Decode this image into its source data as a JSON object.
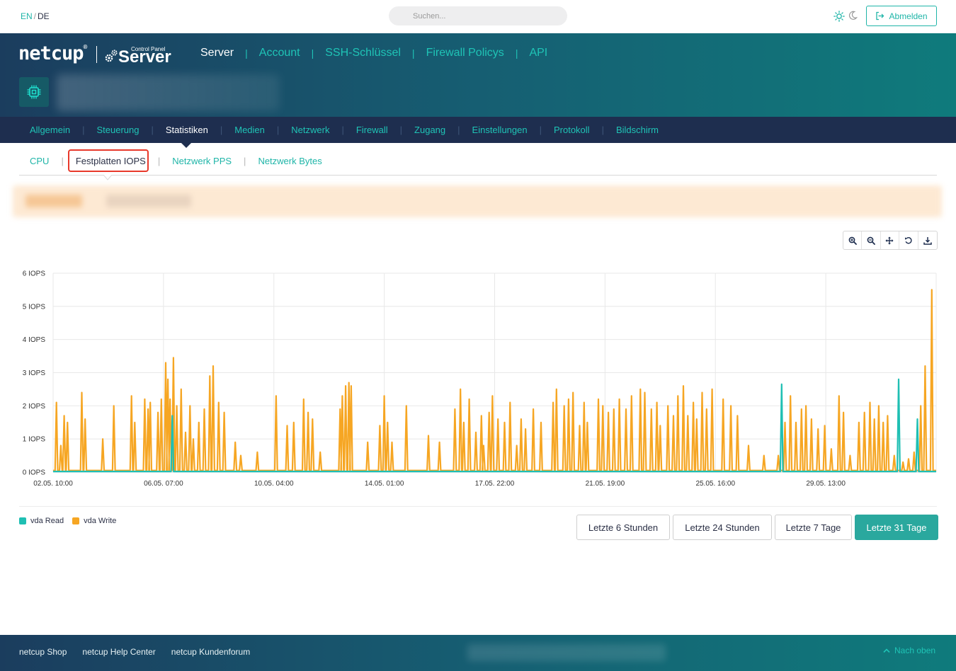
{
  "topbar": {
    "lang_en": "EN",
    "lang_sep": "/",
    "lang_de": "DE",
    "search_placeholder": "Suchen...",
    "logout_label": "Abmelden"
  },
  "brand": {
    "name": "netcup",
    "registered": "®",
    "product": "Server",
    "product_sub": "Control Panel"
  },
  "main_nav": {
    "items": [
      {
        "label": "Server",
        "active": true
      },
      {
        "label": "Account",
        "active": false
      },
      {
        "label": "SSH-Schlüssel",
        "active": false
      },
      {
        "label": "Firewall Policys",
        "active": false
      },
      {
        "label": "API",
        "active": false
      }
    ]
  },
  "tabs": {
    "items": [
      {
        "label": "Allgemein"
      },
      {
        "label": "Steuerung"
      },
      {
        "label": "Statistiken"
      },
      {
        "label": "Medien"
      },
      {
        "label": "Netzwerk"
      },
      {
        "label": "Firewall"
      },
      {
        "label": "Zugang"
      },
      {
        "label": "Einstellungen"
      },
      {
        "label": "Protokoll"
      },
      {
        "label": "Bildschirm"
      }
    ],
    "active_index": 2
  },
  "subtabs": {
    "items": [
      {
        "label": "CPU"
      },
      {
        "label": "Festplatten IOPS"
      },
      {
        "label": "Netzwerk PPS"
      },
      {
        "label": "Netzwerk Bytes"
      }
    ],
    "active_index": 1
  },
  "chart_data": {
    "type": "line",
    "title": "",
    "xlabel": "",
    "ylabel": "",
    "ylim": [
      0,
      6
    ],
    "y_ticks": [
      "0 IOPS",
      "1 IOPS",
      "2 IOPS",
      "3 IOPS",
      "4 IOPS",
      "5 IOPS",
      "6 IOPS"
    ],
    "x_ticks": [
      "02.05. 10:00",
      "06.05. 07:00",
      "10.05. 04:00",
      "14.05. 01:00",
      "17.05. 22:00",
      "21.05. 19:00",
      "25.05. 16:00",
      "29.05. 13:00"
    ],
    "x_range_ticks": [
      0,
      8
    ],
    "grid": true,
    "legend": "bottom-left",
    "series": [
      {
        "name": "vda Read",
        "color": "#1fbfb3",
        "spikes": [
          [
            1.08,
            1.7
          ],
          [
            6.6,
            2.65
          ],
          [
            7.66,
            2.8
          ],
          [
            7.83,
            1.6
          ]
        ]
      },
      {
        "name": "vda Write",
        "color": "#f6a623",
        "spikes": [
          [
            0.03,
            2.1
          ],
          [
            0.07,
            0.8
          ],
          [
            0.1,
            1.7
          ],
          [
            0.13,
            1.5
          ],
          [
            0.26,
            2.4
          ],
          [
            0.29,
            1.6
          ],
          [
            0.45,
            1.0
          ],
          [
            0.55,
            2.0
          ],
          [
            0.71,
            2.3
          ],
          [
            0.74,
            1.5
          ],
          [
            0.83,
            2.2
          ],
          [
            0.86,
            1.9
          ],
          [
            0.88,
            2.1
          ],
          [
            0.95,
            1.8
          ],
          [
            0.98,
            2.2
          ],
          [
            1.02,
            3.3
          ],
          [
            1.04,
            2.8
          ],
          [
            1.06,
            2.2
          ],
          [
            1.09,
            3.45
          ],
          [
            1.12,
            2.0
          ],
          [
            1.16,
            2.5
          ],
          [
            1.2,
            1.2
          ],
          [
            1.24,
            2.0
          ],
          [
            1.27,
            1.0
          ],
          [
            1.32,
            1.5
          ],
          [
            1.37,
            1.9
          ],
          [
            1.42,
            2.9
          ],
          [
            1.45,
            3.2
          ],
          [
            1.5,
            2.1
          ],
          [
            1.55,
            1.8
          ],
          [
            1.65,
            0.9
          ],
          [
            1.7,
            0.5
          ],
          [
            1.85,
            0.6
          ],
          [
            2.02,
            2.3
          ],
          [
            2.12,
            1.4
          ],
          [
            2.18,
            1.5
          ],
          [
            2.27,
            2.2
          ],
          [
            2.31,
            1.8
          ],
          [
            2.35,
            1.6
          ],
          [
            2.42,
            0.6
          ],
          [
            2.6,
            1.9
          ],
          [
            2.62,
            2.3
          ],
          [
            2.65,
            2.6
          ],
          [
            2.68,
            2.7
          ],
          [
            2.7,
            2.6
          ],
          [
            2.85,
            0.9
          ],
          [
            2.96,
            1.4
          ],
          [
            3.0,
            2.3
          ],
          [
            3.03,
            1.5
          ],
          [
            3.07,
            0.9
          ],
          [
            3.2,
            2.0
          ],
          [
            3.4,
            1.1
          ],
          [
            3.5,
            0.9
          ],
          [
            3.64,
            1.9
          ],
          [
            3.69,
            2.5
          ],
          [
            3.72,
            1.5
          ],
          [
            3.77,
            2.2
          ],
          [
            3.83,
            1.2
          ],
          [
            3.88,
            1.7
          ],
          [
            3.9,
            0.8
          ],
          [
            3.95,
            1.8
          ],
          [
            3.98,
            2.3
          ],
          [
            4.03,
            1.6
          ],
          [
            4.09,
            1.5
          ],
          [
            4.14,
            2.1
          ],
          [
            4.2,
            0.8
          ],
          [
            4.24,
            1.6
          ],
          [
            4.28,
            1.3
          ],
          [
            4.35,
            1.9
          ],
          [
            4.42,
            1.5
          ],
          [
            4.53,
            2.1
          ],
          [
            4.56,
            2.5
          ],
          [
            4.63,
            2.0
          ],
          [
            4.67,
            2.2
          ],
          [
            4.71,
            2.4
          ],
          [
            4.77,
            1.4
          ],
          [
            4.81,
            2.1
          ],
          [
            4.84,
            1.5
          ],
          [
            4.94,
            2.2
          ],
          [
            4.98,
            2.0
          ],
          [
            5.03,
            1.8
          ],
          [
            5.08,
            1.9
          ],
          [
            5.13,
            2.2
          ],
          [
            5.19,
            1.9
          ],
          [
            5.24,
            2.3
          ],
          [
            5.32,
            2.5
          ],
          [
            5.36,
            2.4
          ],
          [
            5.42,
            1.9
          ],
          [
            5.47,
            2.1
          ],
          [
            5.5,
            1.4
          ],
          [
            5.57,
            2.0
          ],
          [
            5.62,
            1.7
          ],
          [
            5.66,
            2.3
          ],
          [
            5.71,
            2.6
          ],
          [
            5.75,
            1.7
          ],
          [
            5.8,
            2.1
          ],
          [
            5.83,
            1.6
          ],
          [
            5.88,
            2.4
          ],
          [
            5.92,
            1.9
          ],
          [
            5.97,
            2.5
          ],
          [
            6.07,
            2.2
          ],
          [
            6.14,
            2.0
          ],
          [
            6.2,
            1.7
          ],
          [
            6.3,
            0.8
          ],
          [
            6.44,
            0.5
          ],
          [
            6.57,
            0.5
          ],
          [
            6.63,
            1.5
          ],
          [
            6.68,
            2.3
          ],
          [
            6.73,
            1.5
          ],
          [
            6.78,
            1.9
          ],
          [
            6.82,
            2.0
          ],
          [
            6.87,
            1.6
          ],
          [
            6.93,
            1.3
          ],
          [
            6.99,
            1.4
          ],
          [
            7.05,
            0.7
          ],
          [
            7.12,
            2.3
          ],
          [
            7.16,
            1.8
          ],
          [
            7.22,
            0.5
          ],
          [
            7.3,
            1.5
          ],
          [
            7.35,
            1.8
          ],
          [
            7.4,
            2.1
          ],
          [
            7.44,
            1.6
          ],
          [
            7.48,
            2.0
          ],
          [
            7.52,
            1.5
          ],
          [
            7.56,
            1.7
          ],
          [
            7.62,
            0.5
          ],
          [
            7.7,
            0.3
          ],
          [
            7.75,
            0.4
          ],
          [
            7.8,
            0.6
          ],
          [
            7.86,
            2.0
          ],
          [
            7.9,
            3.2
          ],
          [
            7.96,
            5.5
          ]
        ]
      }
    ]
  },
  "legend": {
    "read_label": "vda Read",
    "write_label": "vda Write",
    "read_color": "#1fbfb3",
    "write_color": "#f6a623"
  },
  "ranges": {
    "items": [
      {
        "label": "Letzte 6 Stunden"
      },
      {
        "label": "Letzte 24 Stunden"
      },
      {
        "label": "Letzte 7 Tage"
      },
      {
        "label": "Letzte 31 Tage"
      }
    ],
    "active_index": 3
  },
  "footer": {
    "links": [
      "netcup Shop",
      "netcup Help Center",
      "netcup Kundenforum"
    ],
    "back_to_top": "Nach oben"
  },
  "colors": {
    "accent": "#1fb5a8",
    "nav_dark": "#1e2e4f",
    "highlight_red": "#e8392b"
  }
}
